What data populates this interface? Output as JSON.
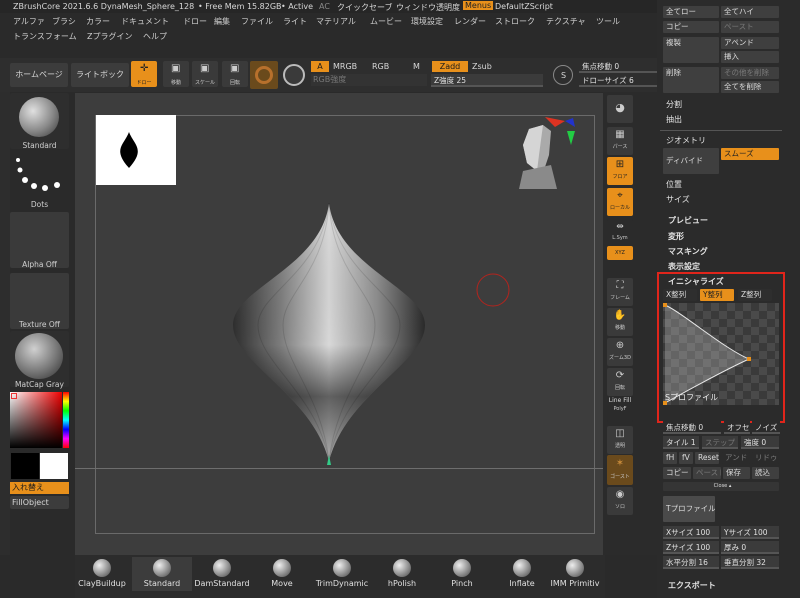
{
  "titlebar": {
    "app": "ZBrushCore 2021.6.6 DynaMesh_Sphere_128",
    "free_mem": "• Free Mem 15.82GB",
    "active": "• Active",
    "ac": "AC",
    "quicksave": "クイックセーブ",
    "window_transparency": "ウィンドウ透明度",
    "menus": "Menus",
    "default_script": "DefaultZScript"
  },
  "menus": {
    "row1": [
      "アルファ",
      "ブラシ",
      "カラー",
      "ドキュメント",
      "ドロー",
      "編集",
      "ファイル",
      "ライト",
      "マテリアル",
      "ムービー",
      "環境設定",
      "レンダー",
      "ストローク",
      "テクスチャ",
      "ツール"
    ],
    "row2": [
      "トランスフォーム",
      "Zプラグイン",
      "ヘルプ"
    ]
  },
  "toolbar": {
    "home": "ホームページ",
    "lightbox": "ライトボックス",
    "draw": "ドロー",
    "move": "移動",
    "scale": "スケール",
    "rotate": "回転",
    "a": "A",
    "mrgb": "MRGB",
    "rgb": "RGB",
    "m": "M",
    "zadd": "Zadd",
    "zsub": "Zsub",
    "rgb_intensity": "RGB強度",
    "z_intensity": "Z強度 25",
    "focal_shift": "焦点移動 0",
    "draw_size": "ドローサイズ 6",
    "s": "S"
  },
  "left_shelf": {
    "brush": "Standard",
    "stroke": "Dots",
    "alpha": "Alpha Off",
    "texture": "Texture Off",
    "material": "MatCap Gray",
    "swap": "入れ替え",
    "fill": "FillObject"
  },
  "right_icons": {
    "perspective": "パース",
    "floor": "フロア",
    "local": "ローカル",
    "symmetry": "L.Sym",
    "xyz": "XYZ",
    "frame": "フレーム",
    "move": "移動",
    "zoom": "ズーム3D",
    "rotate": "回転",
    "linefill": "Line Fill",
    "polyf": "PolyF",
    "transp": "透明",
    "ghost": "ゴースト",
    "solo": "ソロ"
  },
  "right_panel": {
    "hide_all": "全てロー",
    "high_all": "全てハイ",
    "copy": "コピー",
    "paste": "ペースト",
    "duplicate": "複製",
    "append": "アペンド",
    "insert": "挿入",
    "delete": "削除",
    "delete_other": "その他を削除",
    "delete_all": "全てを削除",
    "split": "分割",
    "extract": "抽出",
    "geometry": "ジオメトリ",
    "divide": "ディバイド",
    "smooth": "スムーズ",
    "position": "位置",
    "size": "サイズ",
    "preview": "プレビュー",
    "deform": "変形",
    "masking": "マスキング",
    "display": "表示設定",
    "initialize": "イニシャライズ",
    "x_align": "X整列",
    "y_align": "Y整列",
    "z_align": "Z整列",
    "s_profile": "Sプロファイル",
    "focal": "焦点移動 0",
    "offset": "オフセット",
    "noise": "ノイズ",
    "tile": "タイル 1",
    "step": "ステップ",
    "strength": "強度 0",
    "fh": "fH",
    "fv": "fV",
    "reset": "Reset",
    "undo": "アンド",
    "redo": "リドゥ",
    "copy2": "コピー",
    "paste2": "ペースト",
    "save": "保存",
    "load": "読込",
    "close": "Close ▴",
    "t_profile": "Tプロファイル",
    "x_size": "Xサイズ 100",
    "y_size": "Yサイズ 100",
    "z_size": "Zサイズ 100",
    "thickness": "厚み 0",
    "h_div": "水平分割 16",
    "v_div": "垂直分割 32",
    "export": "エクスポート"
  },
  "bottom_brushes": [
    "ClayBuildup",
    "Standard",
    "DamStandard",
    "Move",
    "TrimDynamic",
    "hPolish",
    "Pinch",
    "Inflate",
    "IMM Primitiv"
  ],
  "colors": {
    "accent": "#e8901b",
    "highlight_box": "#e0251b"
  }
}
